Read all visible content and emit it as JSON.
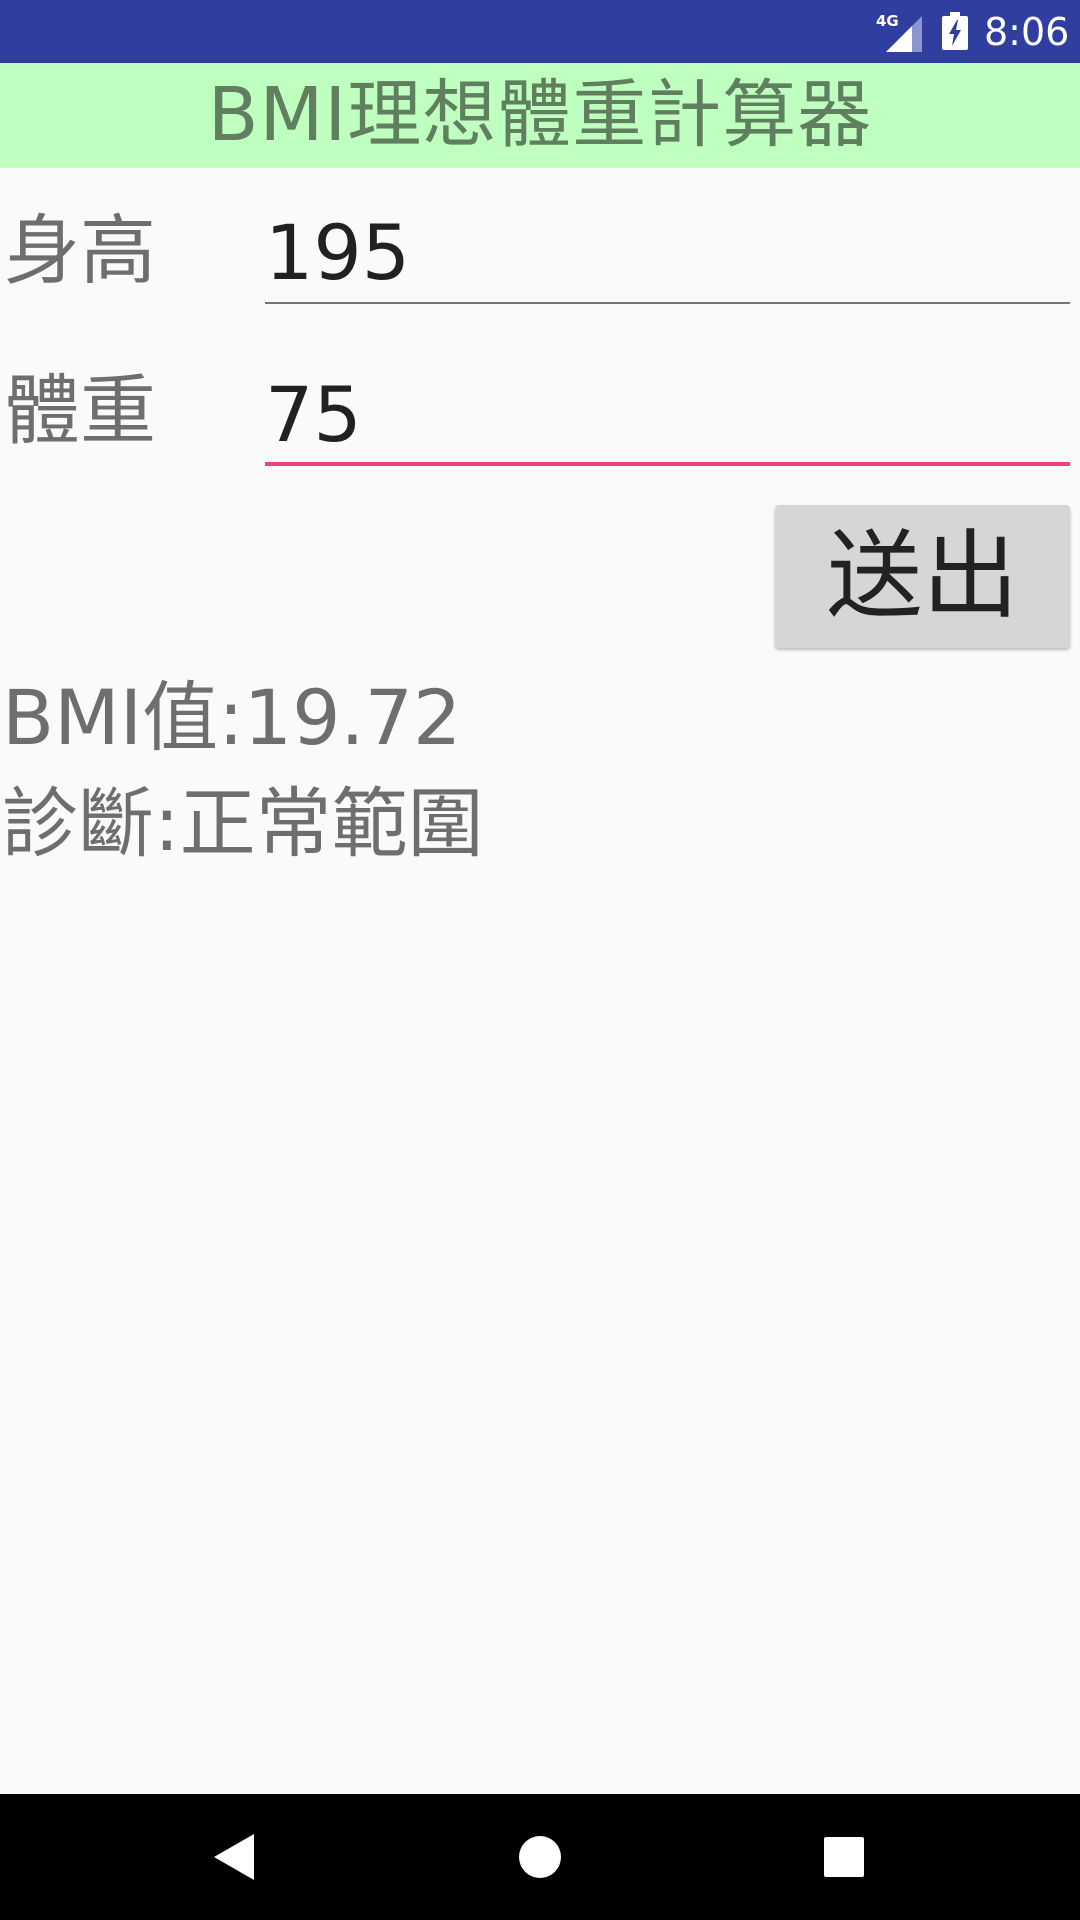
{
  "status_bar": {
    "network": "4G",
    "time": "8:06"
  },
  "header": {
    "title": "BMI理想體重計算器"
  },
  "form": {
    "height_label": "身高",
    "height_value": "195",
    "weight_label": "體重",
    "weight_value": "75",
    "submit_label": "送出"
  },
  "result": {
    "bmi_text": "BMI值:19.72",
    "diagnosis_text": "診斷:正常範圍"
  },
  "colors": {
    "status_bar": "#303F9F",
    "title_background": "#BFFFBF",
    "title_text": "#5F7F5F",
    "focused_underline": "#F0407F"
  },
  "nav_bar": {
    "icons": [
      "back-icon",
      "home-icon",
      "recents-icon"
    ]
  }
}
